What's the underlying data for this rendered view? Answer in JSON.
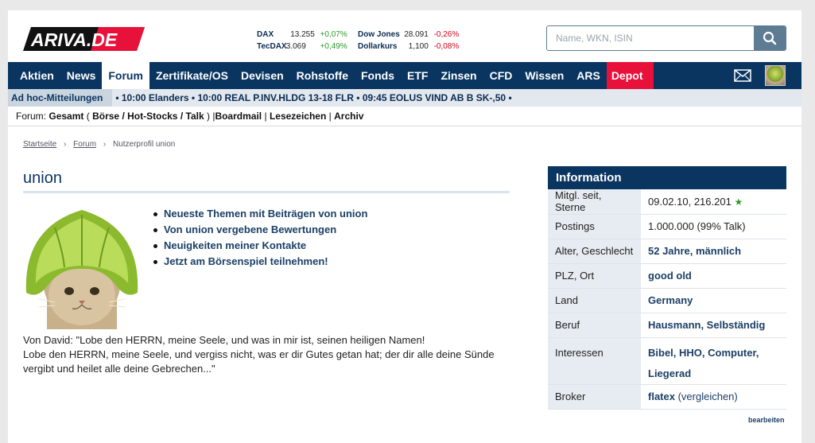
{
  "header": {
    "logo_text": "ARIVA.DE",
    "quotes_left": [
      {
        "name": "DAX",
        "value": "13.255",
        "change": "+0,07%",
        "dir": "pos"
      },
      {
        "name": "TecDAX",
        "value": "3.069",
        "change": "+0,49%",
        "dir": "pos"
      }
    ],
    "quotes_right": [
      {
        "name": "Dow Jones",
        "value": "28.091",
        "change": "-0,26%",
        "dir": "neg"
      },
      {
        "name": "Dollarkurs",
        "value": "1,100",
        "change": "-0,08%",
        "dir": "neg"
      }
    ],
    "search_placeholder": "Name, WKN, ISIN"
  },
  "nav": {
    "items": [
      "Aktien",
      "News",
      "Forum",
      "Zertifikate/OS",
      "Devisen",
      "Rohstoffe",
      "Fonds",
      "ETF",
      "Zinsen",
      "CFD",
      "Wissen",
      "ARS",
      "Depot"
    ],
    "active": "Forum"
  },
  "ticker": {
    "label": "Ad hoc-Mitteilungen",
    "text": "• 10:00 Elanders • 10:00 REAL P.INV.HLDG 13-18 FLR • 09:45 EOLUS VIND AB B SK-,50 •"
  },
  "forumbar": {
    "prefix": "Forum:",
    "gesamt": "Gesamt",
    "open": "(",
    "sub1": "Börse",
    "sub2": "Hot-Stocks",
    "sub3": "Talk",
    "close": ")",
    "boardmail": "Boardmail",
    "lesezeichen": "Lesezeichen",
    "archiv": "Archiv",
    "pipe": "|",
    "slash": "/"
  },
  "breadcrumb": {
    "home": "Startseite",
    "forum": "Forum",
    "current": "Nutzerprofil union"
  },
  "profile": {
    "name": "union",
    "links": [
      "Neueste Themen mit Beiträgen von union",
      "Von union vergebene Bewertungen",
      "Neuigkeiten meiner Kontakte",
      "Jetzt am Börsenspiel teilnehmen!"
    ],
    "quote_line1": "Von David: \"Lobe den HERRN, meine Seele, und was in mir ist, seinen heiligen Namen!",
    "quote_line2": "Lobe den HERRN, meine Seele, und vergiss nicht, was er dir Gutes getan hat; der dir alle deine Sünde vergibt und heilet alle deine Gebrechen...\""
  },
  "info": {
    "title": "Information",
    "member_label": "Mitgl. seit, Sterne",
    "member_value": "09.02.10, 216.201",
    "postings_label": "Postings",
    "postings_value": "1.000.000 (99% Talk)",
    "age_label": "Alter, Geschlecht",
    "age_value": "52 Jahre, männlich",
    "plz_label": "PLZ, Ort",
    "plz_value": "good old",
    "land_label": "Land",
    "land_value": "Germany",
    "beruf_label": "Beruf",
    "beruf_value": "Hausmann, Selbständig",
    "interessen_label": "Interessen",
    "interessen_value": "Bibel, HHO, Computer, Liegerad",
    "broker_label": "Broker",
    "broker_value": "flatex",
    "broker_compare": "(vergleichen)",
    "edit": "bearbeiten"
  }
}
